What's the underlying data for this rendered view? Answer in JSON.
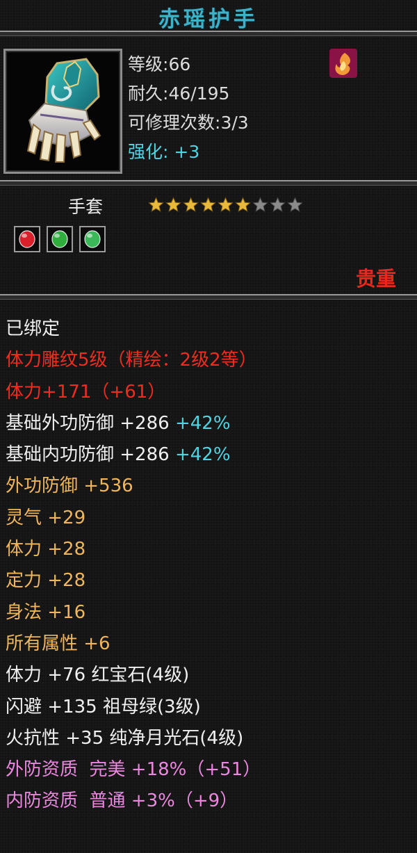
{
  "item": {
    "name": "赤瑶护手",
    "icon": "gauntlet-icon",
    "class_icon": "flame-class-icon",
    "stats": {
      "level_label": "等级",
      "level": "66",
      "durability_label": "耐久",
      "durability": "46/195",
      "repair_label": "可修理次数",
      "repair": "3/3",
      "enhance_label": "强化:",
      "enhance": "+3"
    },
    "type": "手套",
    "stars": {
      "filled": 6,
      "total": 9
    },
    "gems": [
      {
        "name": "ruby-gem-icon",
        "color": "#d8202a"
      },
      {
        "name": "emerald-gem-icon",
        "color": "#2fae3e"
      },
      {
        "name": "moonstone-gem-icon",
        "color": "#3bb85a"
      }
    ],
    "rarity": "贵重"
  },
  "attributes": [
    {
      "color": "white",
      "parts": [
        {
          "text": "已绑定"
        }
      ]
    },
    {
      "color": "red",
      "parts": [
        {
          "text": "体力雕纹5级（精绘：2级2等）"
        }
      ]
    },
    {
      "color": "red",
      "parts": [
        {
          "text": "体力+171（+61）"
        }
      ]
    },
    {
      "color": "white",
      "parts": [
        {
          "text": "基础外功防御 +286 "
        },
        {
          "text": "+42%",
          "color": "cyan"
        }
      ]
    },
    {
      "color": "white",
      "parts": [
        {
          "text": "基础内功防御 +286 "
        },
        {
          "text": "+42%",
          "color": "cyan"
        }
      ]
    },
    {
      "color": "orange",
      "parts": [
        {
          "text": "外功防御 +536"
        }
      ]
    },
    {
      "color": "orange",
      "parts": [
        {
          "text": "灵气 +29"
        }
      ]
    },
    {
      "color": "orange",
      "parts": [
        {
          "text": "体力 +28"
        }
      ]
    },
    {
      "color": "orange",
      "parts": [
        {
          "text": "定力 +28"
        }
      ]
    },
    {
      "color": "orange",
      "parts": [
        {
          "text": "身法 +16"
        }
      ]
    },
    {
      "color": "orange",
      "parts": [
        {
          "text": "所有属性 +6"
        }
      ]
    },
    {
      "color": "white",
      "parts": [
        {
          "text": "体力 +76 红宝石(4级)"
        }
      ]
    },
    {
      "color": "white",
      "parts": [
        {
          "text": "闪避 +135 祖母绿(3级)"
        }
      ]
    },
    {
      "color": "white",
      "parts": [
        {
          "text": "火抗性 +35 纯净月光石(4级)"
        }
      ]
    },
    {
      "color": "pink",
      "parts": [
        {
          "text": "外防资质  完美 +18%（+51）"
        }
      ]
    },
    {
      "color": "pink",
      "parts": [
        {
          "text": "内防资质  普通 +3%（+9）"
        }
      ]
    }
  ],
  "colors": {
    "title": "#3fb1c9",
    "white": "#f0f0f0",
    "red": "#ee2d20",
    "orange": "#f0b65c",
    "pink": "#ec87e0",
    "cyan": "#4fd4e4",
    "star_filled": "#e8b93a",
    "star_empty": "#8a8a8a"
  }
}
